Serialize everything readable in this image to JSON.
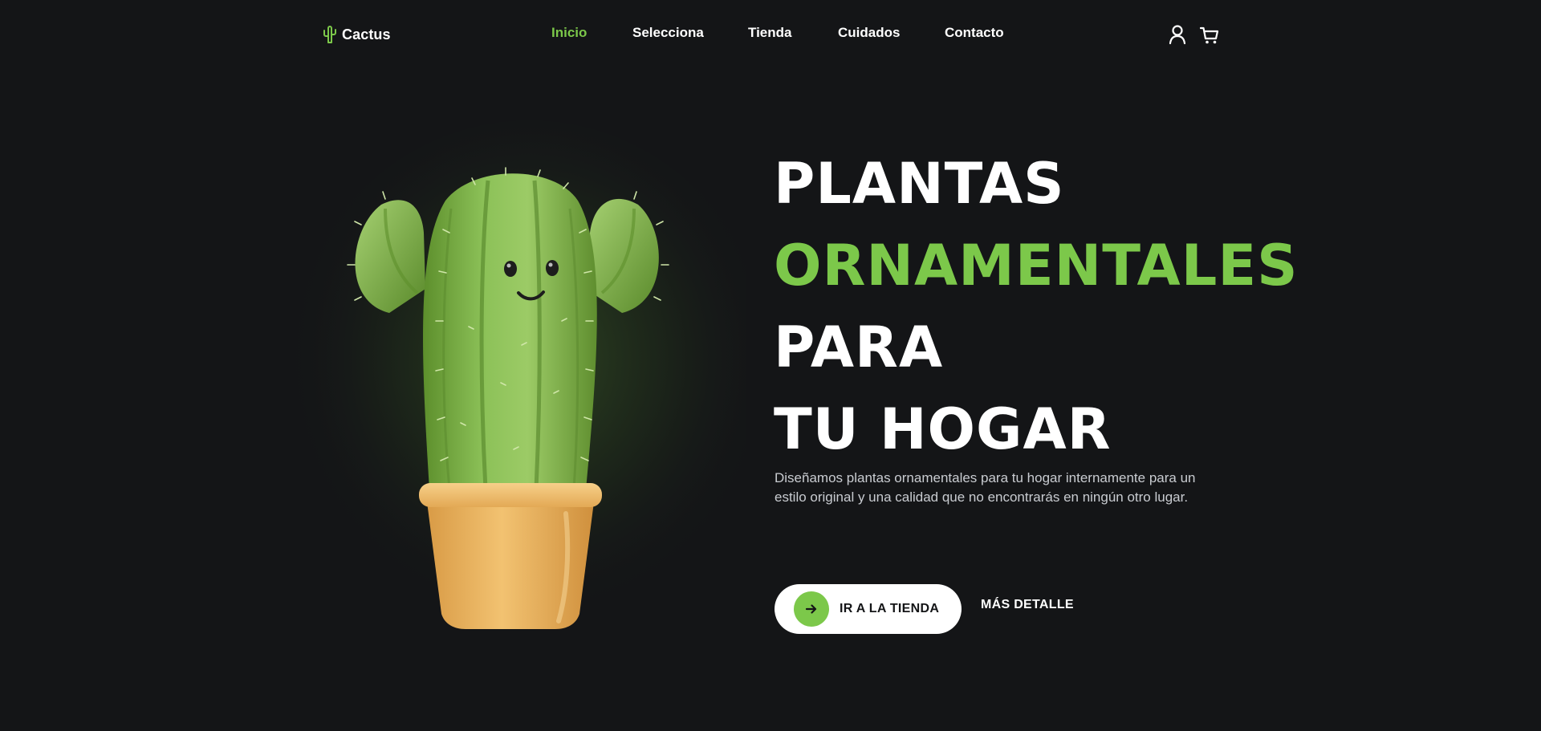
{
  "brand": {
    "name": "Cactus",
    "icon": "cactus-icon",
    "accent_color": "#7cc84a"
  },
  "nav": {
    "items": [
      {
        "label": "Inicio",
        "active": true
      },
      {
        "label": "Selecciona",
        "active": false
      },
      {
        "label": "Tienda",
        "active": false
      },
      {
        "label": "Cuidados",
        "active": false
      },
      {
        "label": "Contacto",
        "active": false
      }
    ]
  },
  "header_icons": {
    "account": "user-icon",
    "cart": "cart-icon"
  },
  "hero": {
    "headline": [
      "PLANTAS",
      "ORNAMENTALES",
      "PARA",
      "TU HOGAR"
    ],
    "description": "Diseñamos plantas ornamentales para tu hogar internamente para un estilo original y una calidad que no encontrarás en ningún otro lugar.",
    "primary_button": {
      "label": "IR A LA TIENDA",
      "icon": "arrow-right-icon"
    },
    "secondary_button": {
      "label": "MÁS DETALLE"
    },
    "image": "smiling-cactus-in-pot"
  },
  "colors": {
    "background": "#141517",
    "text": "#ffffff",
    "accent": "#7cc84a",
    "muted_text": "#c9ccd1"
  }
}
